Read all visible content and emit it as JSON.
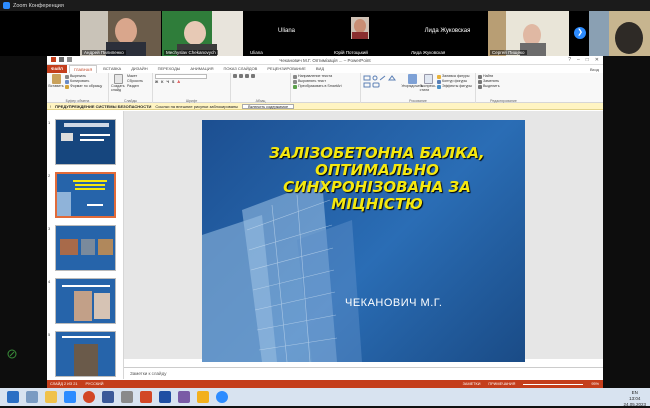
{
  "zoom": {
    "title": "Zoom Конференция"
  },
  "participants": [
    {
      "name": "Андрей Пилипенко"
    },
    {
      "name": "Mechyslav Chekanovych"
    },
    {
      "name": "Uliana"
    },
    {
      "name": "Юрій Потоцький"
    },
    {
      "name": "Лида Жуковская"
    },
    {
      "name": "Сергей Пищеко"
    }
  ],
  "participant_big_names": {
    "uliana": "Uliana",
    "lida": "Лида Жуковская"
  },
  "powerpoint": {
    "title": "Чеканович М.Г. Оптимізація ... – PowerPoint",
    "tabs": [
      "ФАЙЛ",
      "ГЛАВНАЯ",
      "ВСТАВКА",
      "ДИЗАЙН",
      "ПЕРЕХОДЫ",
      "АНИМАЦИЯ",
      "ПОКАЗ СЛАЙДОВ",
      "РЕЦЕНЗИРОВАНИЕ",
      "ВИД"
    ],
    "account": "Вход",
    "ribbon": {
      "paste": "Вставить",
      "cut": "Вырезать",
      "copy": "Копировать",
      "format_painter": "Формат по образцу",
      "clipboard": "Буфер обмена",
      "new_slide": "Создать слайд",
      "layout": "Макет",
      "reset": "Сбросить",
      "section": "Раздел",
      "slides": "Слайды",
      "font": "Шрифт",
      "paragraph": "Абзац",
      "text_direction": "Направление текста",
      "align_text": "Выровнять текст",
      "smartart": "Преобразовать в SmartArt",
      "arrange": "Упорядочить",
      "quick_styles": "Экспресс-стили",
      "shape_fill": "Заливка фигуры",
      "shape_outline": "Контур фигуры",
      "shape_effects": "Эффекты фигуры",
      "drawing": "Рисование",
      "find": "Найти",
      "replace": "Заменить",
      "select": "Выделить",
      "editing": "Редактирование"
    },
    "warning": {
      "label": "ПРЕДУПРЕЖДЕНИЕ СИСТЕМЫ БЕЗОПАСНОСТИ",
      "text": "Ссылки на внешние рисунки заблокированы",
      "button": "Включить содержимое"
    },
    "slide": {
      "title": "ЗАЛІЗОБЕТОННА БАЛКА, ОПТИМАЛЬНО СИНХРОНІЗОВАНА ЗА МІЦНІСТЮ",
      "author": "ЧЕКАНОВИЧ М.Г."
    },
    "thumb_numbers": [
      "1",
      "2",
      "3",
      "4",
      "5"
    ],
    "notes_placeholder": "Заметки к слайду",
    "status": {
      "slide": "СЛАЙД 2 ИЗ 21",
      "lang": "РУССКИЙ",
      "notes": "ЗАМЕТКИ",
      "comments": "ПРИМЕЧАНИЯ",
      "zoom": "95%"
    }
  },
  "taskbar": {
    "lang": "EN",
    "time": "13:04",
    "date": "24.05.2023"
  },
  "colors": {
    "accent": "#c43e1c",
    "slide_title": "#f5e80f",
    "zoom_blue": "#2d8cff"
  }
}
